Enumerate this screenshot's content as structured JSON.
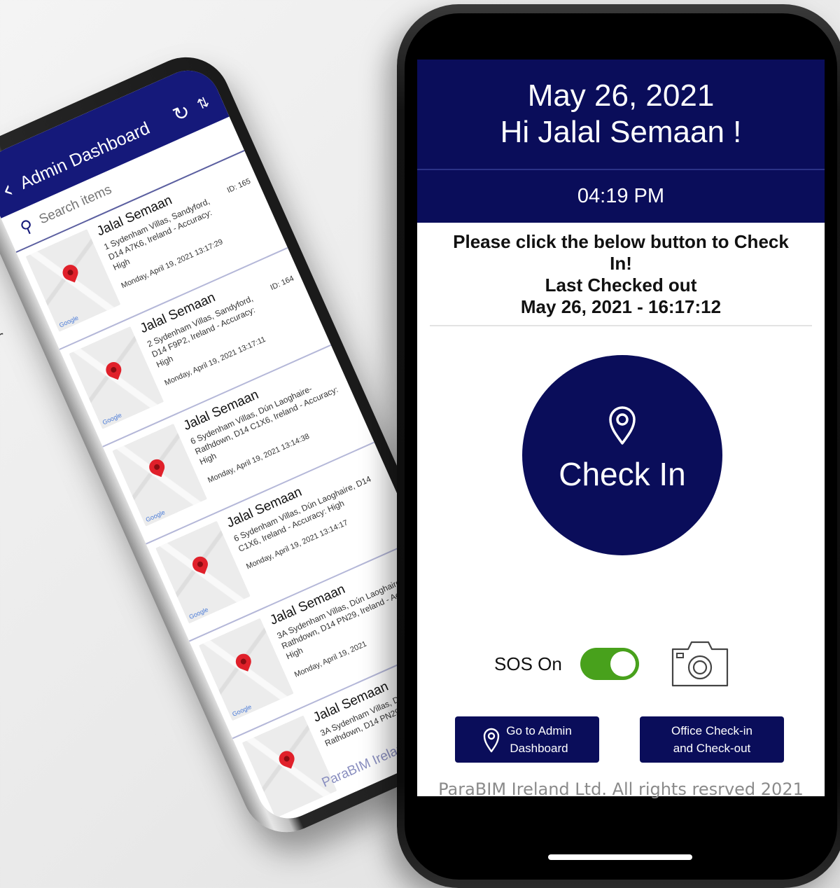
{
  "background": {
    "edge_letter": "r"
  },
  "admin_dashboard": {
    "back_icon": "chevron-left-icon",
    "title": "Admin Dashboard",
    "refresh_icon": "refresh-icon",
    "sort_icon": "sort-icon",
    "search": {
      "icon": "search-icon",
      "placeholder": "Search items"
    },
    "items": [
      {
        "name": "Jalal Semaan",
        "address": "1 Sydenham Villas, Sandyford, D14 A7K6, Ireland - Accuracy: High",
        "id": "ID: 165",
        "date": "Monday, April 19, 2021 13:17:29",
        "map_label": "Google"
      },
      {
        "name": "Jalal Semaan",
        "address": "2 Sydenham Villas, Sandyford, D14 F9P2, Ireland - Accuracy: High",
        "id": "ID: 164",
        "date": "Monday, April 19, 2021 13:17:11",
        "map_label": "Google"
      },
      {
        "name": "Jalal Semaan",
        "address": "6 Sydenham Villas, Dún Laoghaire-Rathdown, D14 C1X6, Ireland - Accuracy: High",
        "id": "",
        "date": "Monday, April 19, 2021 13:14:38",
        "map_label": "Google"
      },
      {
        "name": "Jalal Semaan",
        "address": "6 Sydenham Villas, Dún Laoghaire, D14 C1X6, Ireland - Accuracy: High",
        "id": "",
        "date": "Monday, April 19, 2021 13:14:17",
        "map_label": "Google"
      },
      {
        "name": "Jalal Semaan",
        "address": "3A Sydenham Villas, Dún Laoghaire-Rathdown, D14 PN29, Ireland - Accuracy: High",
        "id": "",
        "date": "Monday, April 19, 2021",
        "map_label": "Google"
      },
      {
        "name": "Jalal Semaan",
        "address": "3A Sydenham Villas, Dún Laoghaire-Rathdown, D14 PN29",
        "id": "",
        "date": "",
        "map_label": ""
      }
    ],
    "footer": "ParaBIM Ireland Ltd."
  },
  "checkin_app": {
    "date": "May 26, 2021",
    "greeting": "Hi Jalal Semaan !",
    "time": "04:19 PM",
    "message_line1": "Please click the below button to Check",
    "message_line2": "In!",
    "message_line3": "Last Checked out",
    "message_line4": "May 26, 2021 - 16:17:12",
    "checkin_button": {
      "icon": "location-pin-icon",
      "label": "Check In"
    },
    "sos": {
      "label": "SOS On",
      "on": true,
      "color": "#48a11c"
    },
    "camera_icon": "camera-icon",
    "admin_button": {
      "icon": "location-pin-icon",
      "line1": "Go to Admin",
      "line2": "Dashboard"
    },
    "office_button": {
      "line1": "Office Check-in",
      "line2": "and Check-out"
    },
    "footer": "ParaBIM Ireland Ltd. All rights resrved 2021"
  },
  "colors": {
    "brand_navy": "#0a0d5a",
    "header_blue": "#15197a",
    "toggle_green": "#48a11c",
    "pin_red": "#e0202a"
  }
}
